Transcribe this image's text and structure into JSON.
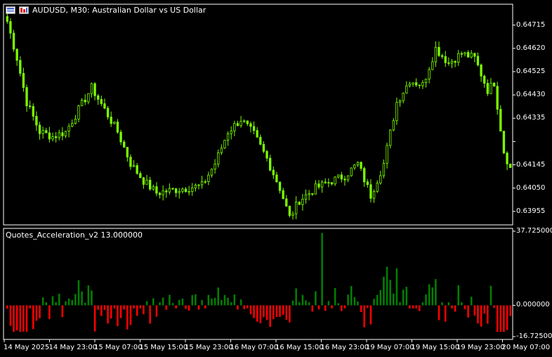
{
  "window": {
    "symbol_title": "AUDUSD, M30:  Australian Dollar vs US Dollar",
    "indicator_title": "Quotes_Acceleration_v2 13.000000"
  },
  "colors": {
    "background": "#000000",
    "frame": "#ffffff",
    "candle": "#7CFC00",
    "positive": "#008000",
    "negative": "#FF0000"
  },
  "price_axis": {
    "labels": [
      "0.64715",
      "0.64620",
      "0.64525",
      "0.64430",
      "0.64335",
      "0.64145",
      "0.64050",
      "0.63955"
    ]
  },
  "indicator_axis": {
    "labels": [
      "37.725000",
      "0.000000",
      "-16.725000"
    ]
  },
  "time_axis": {
    "labels": [
      "14 May 2025",
      "14 May 23:00",
      "15 May 07:00",
      "15 May 15:00",
      "15 May 23:00",
      "16 May 07:00",
      "16 May 15:00",
      "16 May 23:00",
      "19 May 07:00",
      "19 May 15:00",
      "19 May 23:00",
      "20 May 07:00"
    ]
  },
  "chart_data": {
    "type": "candlestick",
    "price_range": [
      0.639,
      0.648
    ],
    "close_keypoints": [
      [
        0,
        0.6473
      ],
      [
        3,
        0.6458
      ],
      [
        6,
        0.644
      ],
      [
        10,
        0.6428
      ],
      [
        14,
        0.6426
      ],
      [
        18,
        0.6428
      ],
      [
        22,
        0.6437
      ],
      [
        26,
        0.6446
      ],
      [
        30,
        0.6437
      ],
      [
        34,
        0.6428
      ],
      [
        38,
        0.6415
      ],
      [
        42,
        0.6408
      ],
      [
        46,
        0.6403
      ],
      [
        50,
        0.6404
      ],
      [
        55,
        0.6405
      ],
      [
        60,
        0.6406
      ],
      [
        64,
        0.6415
      ],
      [
        68,
        0.6428
      ],
      [
        72,
        0.6433
      ],
      [
        76,
        0.6427
      ],
      [
        80,
        0.6417
      ],
      [
        84,
        0.6405
      ],
      [
        87,
        0.6393
      ],
      [
        90,
        0.64
      ],
      [
        95,
        0.6405
      ],
      [
        100,
        0.6408
      ],
      [
        104,
        0.641
      ],
      [
        108,
        0.6415
      ],
      [
        112,
        0.6402
      ],
      [
        116,
        0.6415
      ],
      [
        120,
        0.644
      ],
      [
        124,
        0.6449
      ],
      [
        128,
        0.6447
      ],
      [
        132,
        0.6462
      ],
      [
        136,
        0.6456
      ],
      [
        140,
        0.646
      ],
      [
        144,
        0.6458
      ],
      [
        148,
        0.6445
      ],
      [
        150,
        0.6448
      ],
      [
        153,
        0.642
      ],
      [
        155,
        0.6413
      ]
    ],
    "indicator": {
      "range": [
        -16.725,
        37.725
      ],
      "spike_index": 97,
      "spike_value": 35.5
    }
  }
}
